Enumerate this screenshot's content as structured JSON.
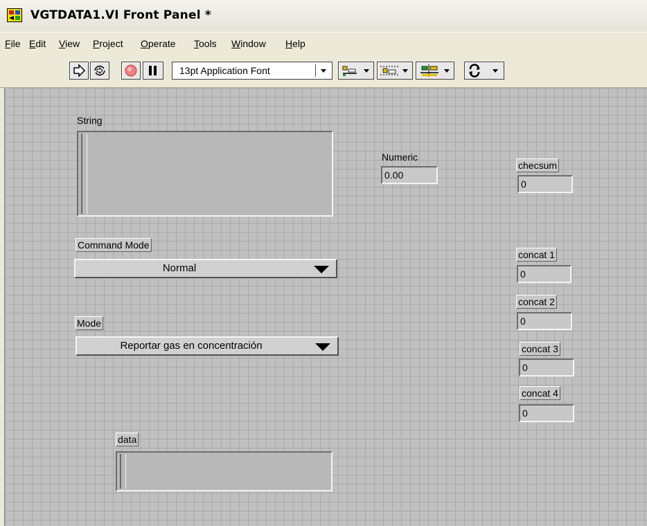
{
  "window": {
    "title": "VGTDATA1.VI Front Panel *"
  },
  "menu": {
    "items": [
      {
        "label": "File",
        "underline": "F"
      },
      {
        "label": "Edit",
        "underline": "E"
      },
      {
        "label": "View",
        "underline": "V"
      },
      {
        "label": "Project",
        "underline": "P"
      },
      {
        "label": "Operate",
        "underline": "O"
      },
      {
        "label": "Tools",
        "underline": "T"
      },
      {
        "label": "Window",
        "underline": "W"
      },
      {
        "label": "Help",
        "underline": "H"
      }
    ]
  },
  "toolbar": {
    "font_selector": "13pt Application Font",
    "icons": [
      "run-arrow-icon",
      "run-continuously-icon",
      "abort-icon",
      "pause-icon",
      "align-objects-icon",
      "distribute-objects-icon",
      "resize-objects-icon",
      "reorder-icon"
    ]
  },
  "panel": {
    "string": {
      "label": "String",
      "value": ""
    },
    "numeric": {
      "label": "Numeric",
      "value": "0.00"
    },
    "checksum": {
      "label": "checsum",
      "value": "0"
    },
    "command_mode": {
      "label": "Command Mode",
      "value": "Normal"
    },
    "mode": {
      "label": "Mode",
      "value": "Reportar gas en concentración"
    },
    "concat": [
      {
        "label": "concat 1",
        "value": "0"
      },
      {
        "label": "concat 2",
        "value": "0"
      },
      {
        "label": "concat 3",
        "value": "0"
      },
      {
        "label": "concat 4",
        "value": "0"
      }
    ],
    "data": {
      "label": "data",
      "value": ""
    }
  },
  "colors": {
    "panel_bg": "#c0c0c0",
    "grid": "#a9a9a9",
    "abort_red": "#e05050"
  }
}
